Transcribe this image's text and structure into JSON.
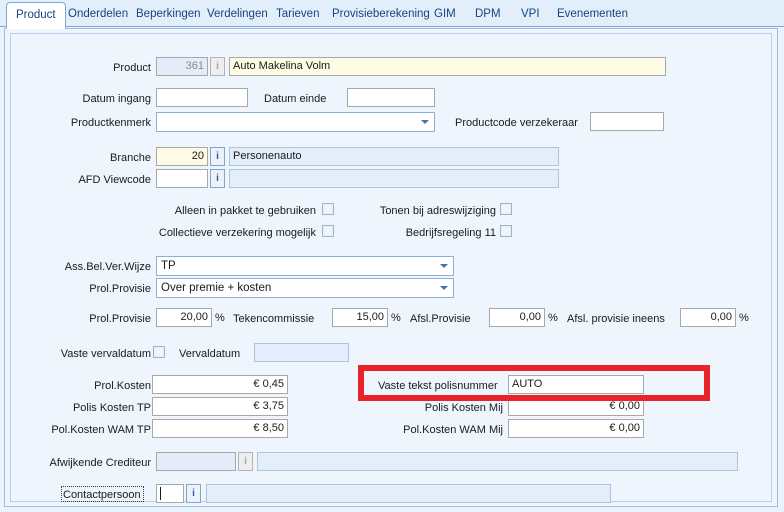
{
  "window": {
    "background_color": "#eaf2fb",
    "panel_color": "#eef5fd"
  },
  "tabs": [
    {
      "label": "Product",
      "active": true
    },
    {
      "label": "Onderdelen",
      "active": false
    },
    {
      "label": "Beperkingen",
      "active": false
    },
    {
      "label": "Verdelingen",
      "active": false
    },
    {
      "label": "Tarieven",
      "active": false
    },
    {
      "label": "Provisieberekening",
      "active": false
    },
    {
      "label": "GIM",
      "active": false
    },
    {
      "label": "DPM",
      "active": false
    },
    {
      "label": "VPI",
      "active": false
    },
    {
      "label": "Evenementen",
      "active": false
    }
  ],
  "form": {
    "product": {
      "label": "Product",
      "code_value": "361",
      "info_icon": "info-icon",
      "name_value": "Auto Makelina Volm"
    },
    "datum_ingang": {
      "label": "Datum ingang",
      "value": ""
    },
    "datum_einde": {
      "label": "Datum einde",
      "value": ""
    },
    "productkenmerk": {
      "label": "Productkenmerk",
      "value": "",
      "arrow_icon": "chevron-down-icon"
    },
    "productcode_verzekeraar": {
      "label": "Productcode verzekeraar",
      "value": ""
    },
    "branche": {
      "label": "Branche",
      "code_value": "20",
      "info_icon": "info-icon",
      "description_value": "Personenauto"
    },
    "afd_viewcode": {
      "label": "AFD Viewcode",
      "code_value": "",
      "info_icon": "info-icon",
      "description_value": ""
    },
    "checkboxes": [
      {
        "label": "Alleen in pakket te gebruiken",
        "checked": false
      },
      {
        "label": "Tonen bij adreswijziging",
        "checked": false
      },
      {
        "label": "Collectieve verzekering mogelijk",
        "checked": false
      },
      {
        "label": "Bedrijfsregeling 11",
        "checked": false
      }
    ],
    "ass_bel_ver_wijze": {
      "label": "Ass.Bel.Ver.Wijze",
      "value": "TP",
      "arrow_icon": "chevron-down-icon"
    },
    "prol_provisie_combo": {
      "label": "Prol.Provisie",
      "value": "Over premie + kosten",
      "arrow_icon": "chevron-down-icon"
    },
    "percent_row": [
      {
        "label": "Prol.Provisie",
        "value": "20,00",
        "unit": "%"
      },
      {
        "label": "Tekencommissie",
        "value": "15,00",
        "unit": "%"
      },
      {
        "label": "Afsl.Provisie",
        "value": "0,00",
        "unit": "%"
      },
      {
        "label": "Afsl. provisie ineens",
        "value": "0,00",
        "unit": "%"
      }
    ],
    "vaste_vervaldatum": {
      "label": "Vaste vervaldatum",
      "checked": false
    },
    "vervaldatum": {
      "label": "Vervaldatum",
      "value": ""
    },
    "costs_left": [
      {
        "label": "Prol.Kosten",
        "value": "€ 0,45"
      },
      {
        "label": "Polis Kosten TP",
        "value": "€ 3,75"
      },
      {
        "label": "Pol.Kosten WAM TP",
        "value": "€ 8,50"
      }
    ],
    "costs_right": [
      {
        "label": "",
        "value": ""
      },
      {
        "label": "Polis Kosten Mij",
        "value": "€ 0,00"
      },
      {
        "label": "Pol.Kosten WAM Mij",
        "value": "€ 0,00"
      }
    ],
    "vaste_tekst_polisnummer": {
      "label": "Vaste tekst polisnummer",
      "value": "AUTO"
    },
    "afwijkende_crediteur": {
      "label": "Afwijkende Crediteur",
      "code_value": "",
      "info_icon": "info-icon",
      "description_value": ""
    },
    "contactpersoon": {
      "label": "Contactpersoon",
      "code_value": "",
      "info_icon": "info-icon",
      "description_value": ""
    }
  },
  "annotation": {
    "name": "highlight-box",
    "color": "#e8232a",
    "target": "Vaste tekst polisnummer"
  }
}
